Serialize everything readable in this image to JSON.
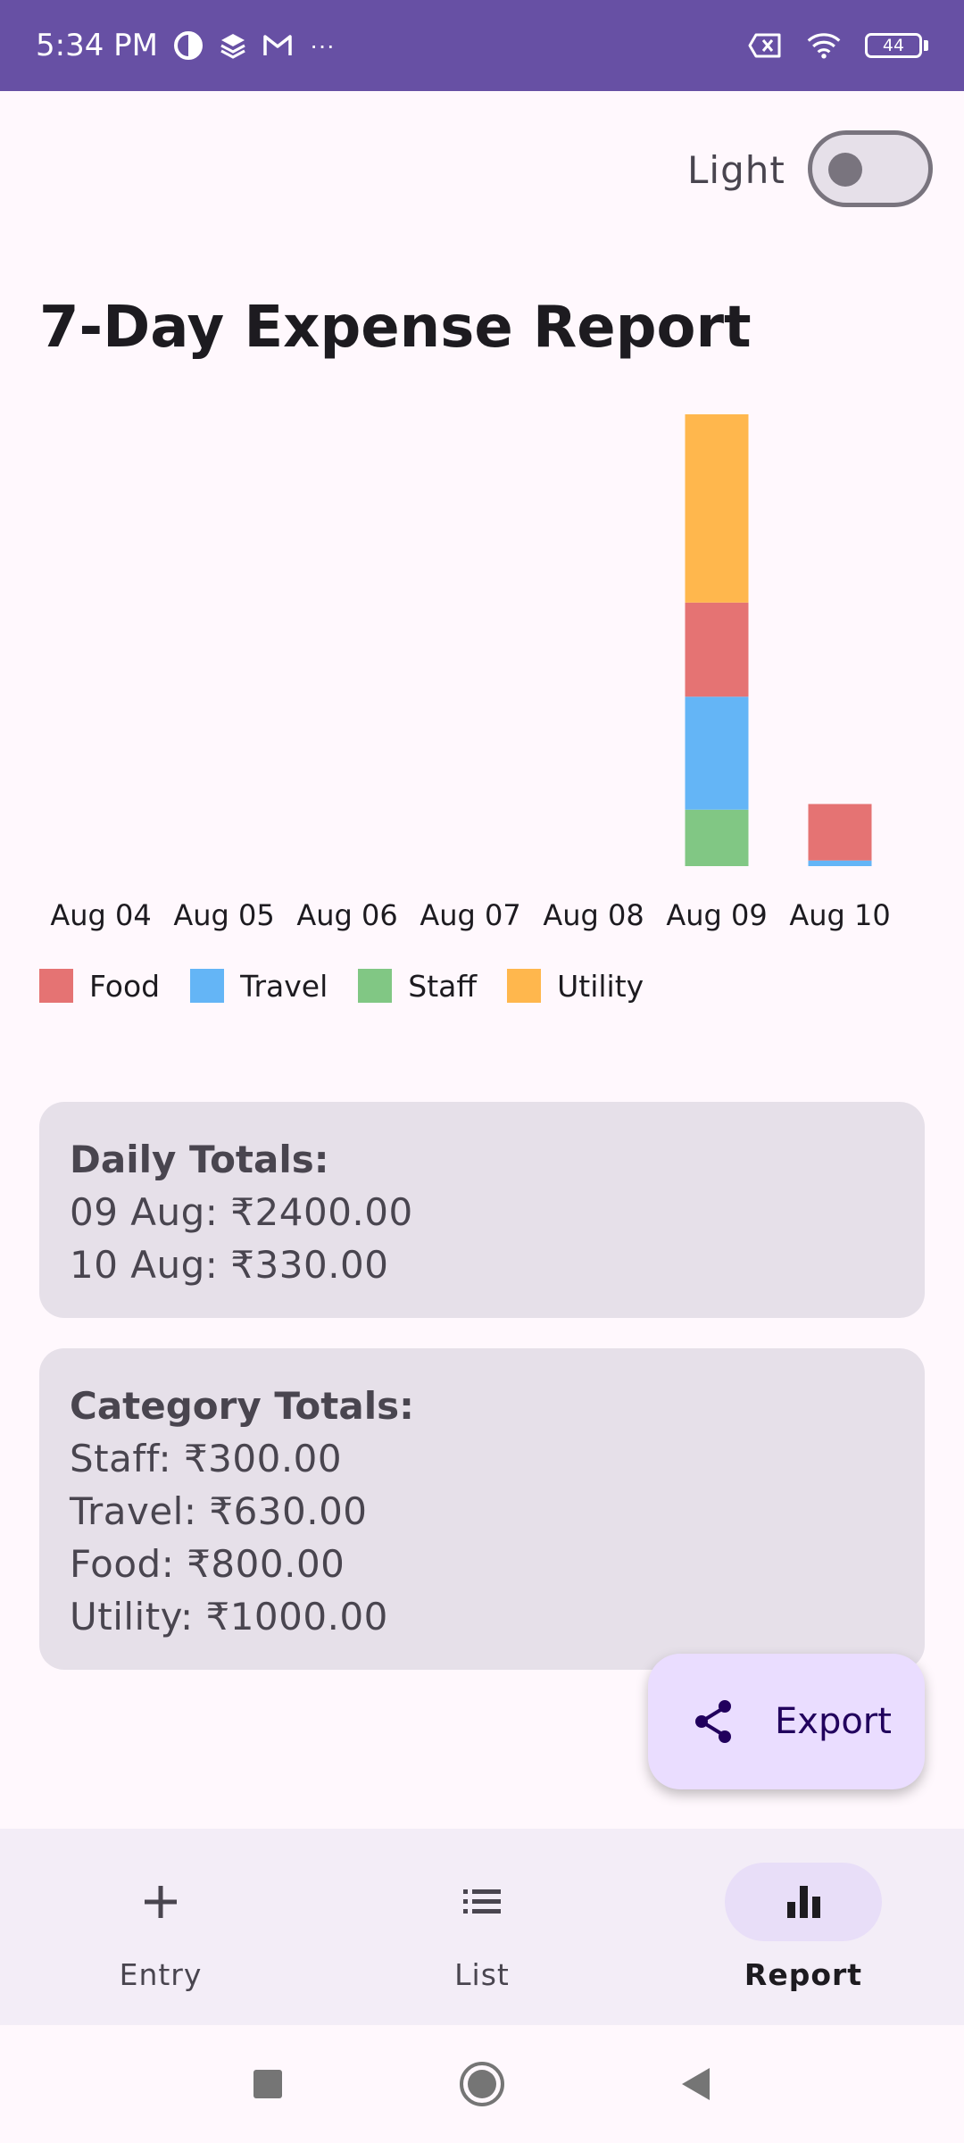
{
  "status_bar": {
    "time": "5:34 PM",
    "more": "···",
    "battery": "44"
  },
  "theme_toggle": {
    "label": "Light",
    "on": false
  },
  "page_title": "7-Day Expense Report",
  "colors": {
    "Food": "#E57373",
    "Travel": "#64B5F6",
    "Staff": "#81C784",
    "Utility": "#FFB74D",
    "accent": "#6750A4"
  },
  "chart_data": {
    "type": "bar",
    "stacked": true,
    "categories": [
      "Aug 04",
      "Aug 05",
      "Aug 06",
      "Aug 07",
      "Aug 08",
      "Aug 09",
      "Aug 10"
    ],
    "series": [
      {
        "name": "Staff",
        "values": [
          0,
          0,
          0,
          0,
          0,
          300,
          0
        ]
      },
      {
        "name": "Travel",
        "values": [
          0,
          0,
          0,
          0,
          0,
          600,
          30
        ]
      },
      {
        "name": "Food",
        "values": [
          0,
          0,
          0,
          0,
          0,
          500,
          300
        ]
      },
      {
        "name": "Utility",
        "values": [
          0,
          0,
          0,
          0,
          0,
          1000,
          0
        ]
      }
    ],
    "ylim": [
      0,
      2400
    ],
    "grid": false,
    "legend_placement": "bottom"
  },
  "legend": [
    {
      "label": "Food"
    },
    {
      "label": "Travel"
    },
    {
      "label": "Staff"
    },
    {
      "label": "Utility"
    }
  ],
  "daily_totals": {
    "heading": "Daily Totals:",
    "lines": [
      "09 Aug: ₹2400.00",
      "10 Aug: ₹330.00"
    ]
  },
  "category_totals": {
    "heading": "Category Totals:",
    "lines": [
      "Staff: ₹300.00",
      "Travel: ₹630.00",
      "Food: ₹800.00",
      "Utility: ₹1000.00"
    ]
  },
  "fab": {
    "label": "Export",
    "icon": "share-icon"
  },
  "bottom_nav": [
    {
      "label": "Entry",
      "icon": "plus-icon",
      "active": false
    },
    {
      "label": "List",
      "icon": "list-icon",
      "active": false
    },
    {
      "label": "Report",
      "icon": "bar-chart-icon",
      "active": true
    }
  ]
}
